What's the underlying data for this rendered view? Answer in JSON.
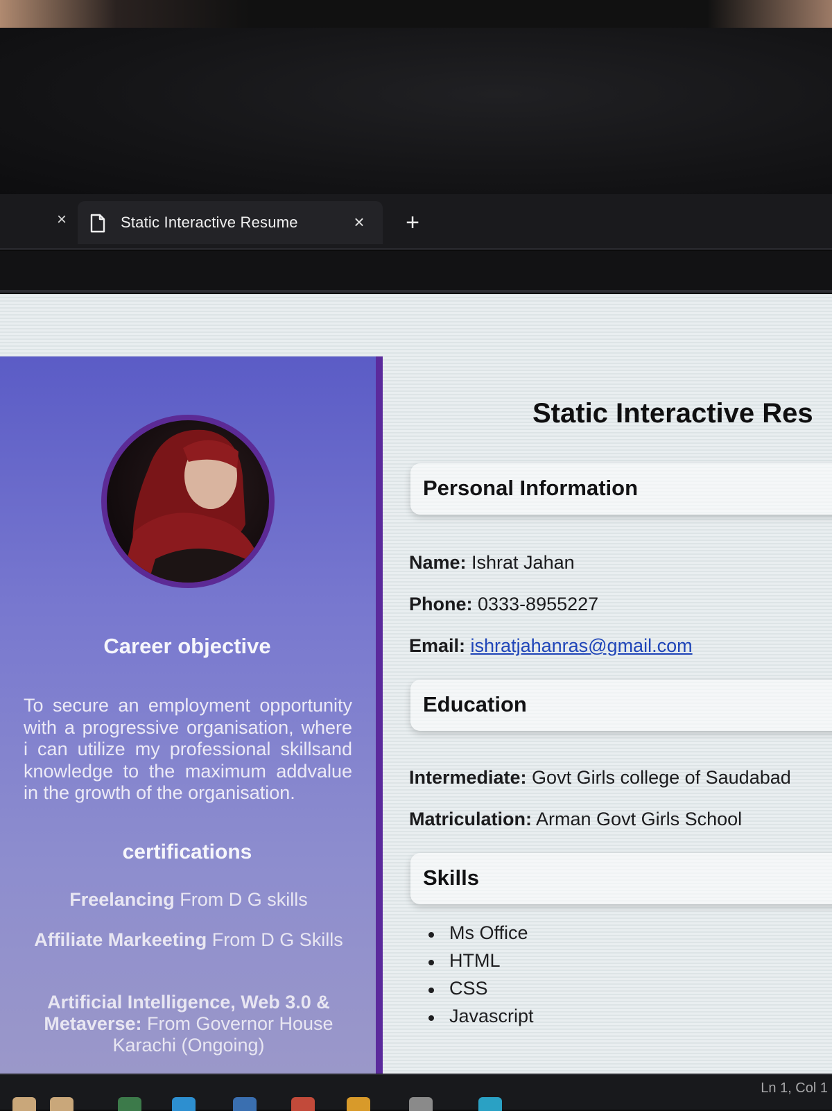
{
  "browser": {
    "tab_title": "Static Interactive Resume",
    "close_symbol": "×",
    "new_tab_symbol": "+"
  },
  "sidebar": {
    "career_heading": "Career objective",
    "career_text": "To secure an employment opportunity with a progressive organisation, where i can utilize my professional skillsand knowledge to the maximum addvalue in the growth of the organisation.",
    "certifications_heading": "certifications",
    "certifications": [
      {
        "title": "Freelancing",
        "detail": " From D G skills"
      },
      {
        "title": "Affiliate Markeeting",
        "detail": " From D G Skills"
      },
      {
        "title": "Artificial Intelligence, Web 3.0 & Metaverse:",
        "detail": " From Governor House Karachi (Ongoing)"
      }
    ]
  },
  "main": {
    "title": "Static Interactive Res",
    "personal": {
      "heading": "Personal Information",
      "name_label": "Name:",
      "name_value": " Ishrat Jahan",
      "phone_label": "Phone:",
      "phone_value": " 0333-8955227",
      "email_label": "Email:",
      "email_value": "ishratjahanras@gmail.com"
    },
    "education": {
      "heading": "Education",
      "intermediate_label": "Intermediate:",
      "intermediate_value": " Govt Girls college of Saudabad",
      "matric_label": "Matriculation:",
      "matric_value": " Arman Govt Girls School"
    },
    "skills": {
      "heading": "Skills",
      "items": [
        "Ms Office",
        "HTML",
        "CSS",
        "Javascript"
      ]
    }
  },
  "status_bar": {
    "position": "Ln 1, Col 1"
  },
  "colors": {
    "sidebar_top": "#5b5cc6",
    "sidebar_bottom": "#9b98c9",
    "sidebar_border": "#5b2a9c",
    "avatar_ring": "#5c2a95",
    "link": "#1f45b8"
  },
  "icons": [
    "close-icon",
    "document-icon",
    "plus-icon"
  ]
}
